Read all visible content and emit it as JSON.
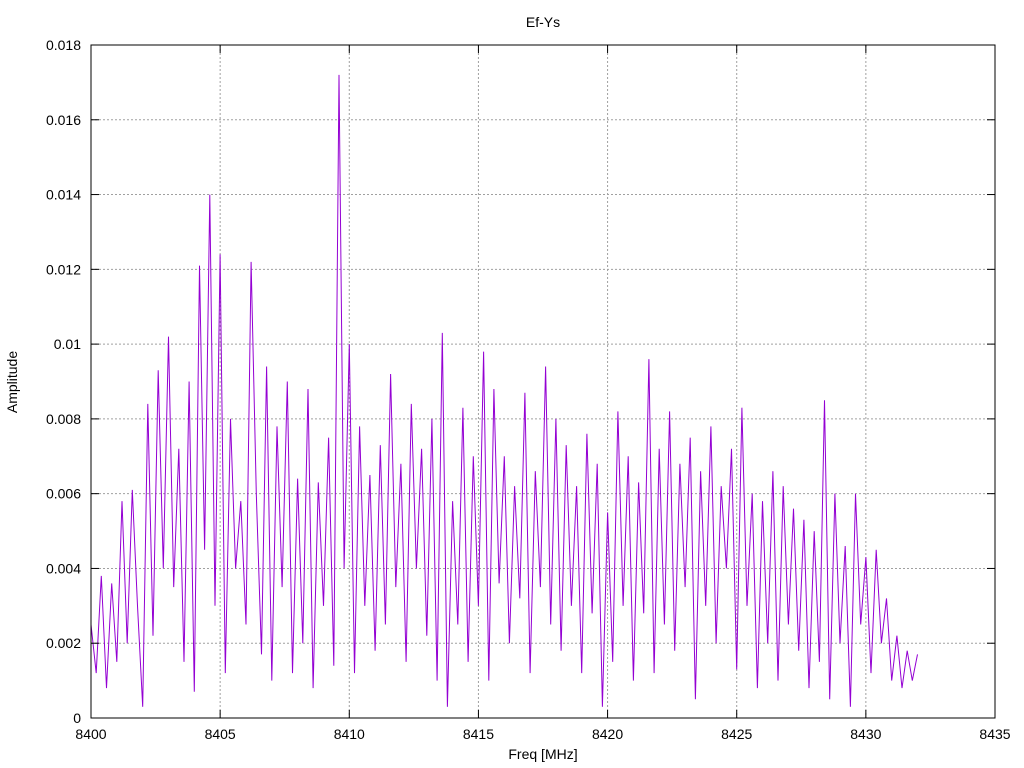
{
  "chart_data": {
    "type": "line",
    "title": "Ef-Ys",
    "xlabel": "Freq [MHz]",
    "ylabel": "Amplitude",
    "xlim": [
      8400,
      8435
    ],
    "ylim": [
      0,
      0.018
    ],
    "grid": true,
    "xticks": [
      8400,
      8405,
      8410,
      8415,
      8420,
      8425,
      8430,
      8435
    ],
    "xtick_labels": [
      "8400",
      "8405",
      "8410",
      "8415",
      "8420",
      "8425",
      "8430",
      "8435"
    ],
    "yticks": [
      0,
      0.002,
      0.004,
      0.006,
      0.008,
      0.01,
      0.012,
      0.014,
      0.016,
      0.018
    ],
    "ytick_labels": [
      "0",
      "0.002",
      "0.004",
      "0.006",
      "0.008",
      "0.01",
      "0.012",
      "0.014",
      "0.016",
      "0.018"
    ],
    "series": [
      {
        "name": "Ef-Ys",
        "color": "#9400d3",
        "x_start": 8400,
        "x_step": 0.2,
        "y": [
          0.0025,
          0.0012,
          0.0038,
          0.0008,
          0.0036,
          0.0015,
          0.0058,
          0.002,
          0.0061,
          0.003,
          0.0003,
          0.0084,
          0.0022,
          0.0093,
          0.004,
          0.0102,
          0.0035,
          0.0072,
          0.0015,
          0.009,
          0.0007,
          0.0121,
          0.0045,
          0.014,
          0.003,
          0.0124,
          0.0012,
          0.008,
          0.004,
          0.0058,
          0.0025,
          0.0122,
          0.006,
          0.0017,
          0.0094,
          0.001,
          0.0078,
          0.0035,
          0.009,
          0.0012,
          0.0064,
          0.002,
          0.0088,
          0.0008,
          0.0063,
          0.003,
          0.0075,
          0.0014,
          0.0172,
          0.004,
          0.01,
          0.0012,
          0.0078,
          0.003,
          0.0065,
          0.0018,
          0.0073,
          0.0025,
          0.0092,
          0.0035,
          0.0068,
          0.0015,
          0.0084,
          0.004,
          0.0072,
          0.0022,
          0.008,
          0.001,
          0.0103,
          0.0003,
          0.0058,
          0.0025,
          0.0083,
          0.0015,
          0.007,
          0.003,
          0.0098,
          0.001,
          0.0088,
          0.0036,
          0.007,
          0.002,
          0.0062,
          0.0032,
          0.0087,
          0.0012,
          0.0066,
          0.0035,
          0.0094,
          0.0025,
          0.008,
          0.0018,
          0.0073,
          0.003,
          0.0062,
          0.0012,
          0.0076,
          0.0028,
          0.0068,
          0.0003,
          0.0055,
          0.0015,
          0.0082,
          0.003,
          0.007,
          0.001,
          0.0063,
          0.0028,
          0.0096,
          0.0012,
          0.0072,
          0.0025,
          0.0082,
          0.0018,
          0.0068,
          0.0035,
          0.0075,
          0.0005,
          0.0066,
          0.003,
          0.0078,
          0.002,
          0.0062,
          0.004,
          0.0072,
          0.0013,
          0.0083,
          0.003,
          0.006,
          0.0008,
          0.0058,
          0.002,
          0.0066,
          0.001,
          0.0062,
          0.0025,
          0.0056,
          0.0018,
          0.0053,
          0.0008,
          0.005,
          0.0015,
          0.0085,
          0.0005,
          0.006,
          0.002,
          0.0046,
          0.0003,
          0.006,
          0.0025,
          0.0043,
          0.0012,
          0.0045,
          0.002,
          0.0032,
          0.001,
          0.0022,
          0.0008,
          0.0018,
          0.001,
          0.0017
        ]
      }
    ]
  }
}
